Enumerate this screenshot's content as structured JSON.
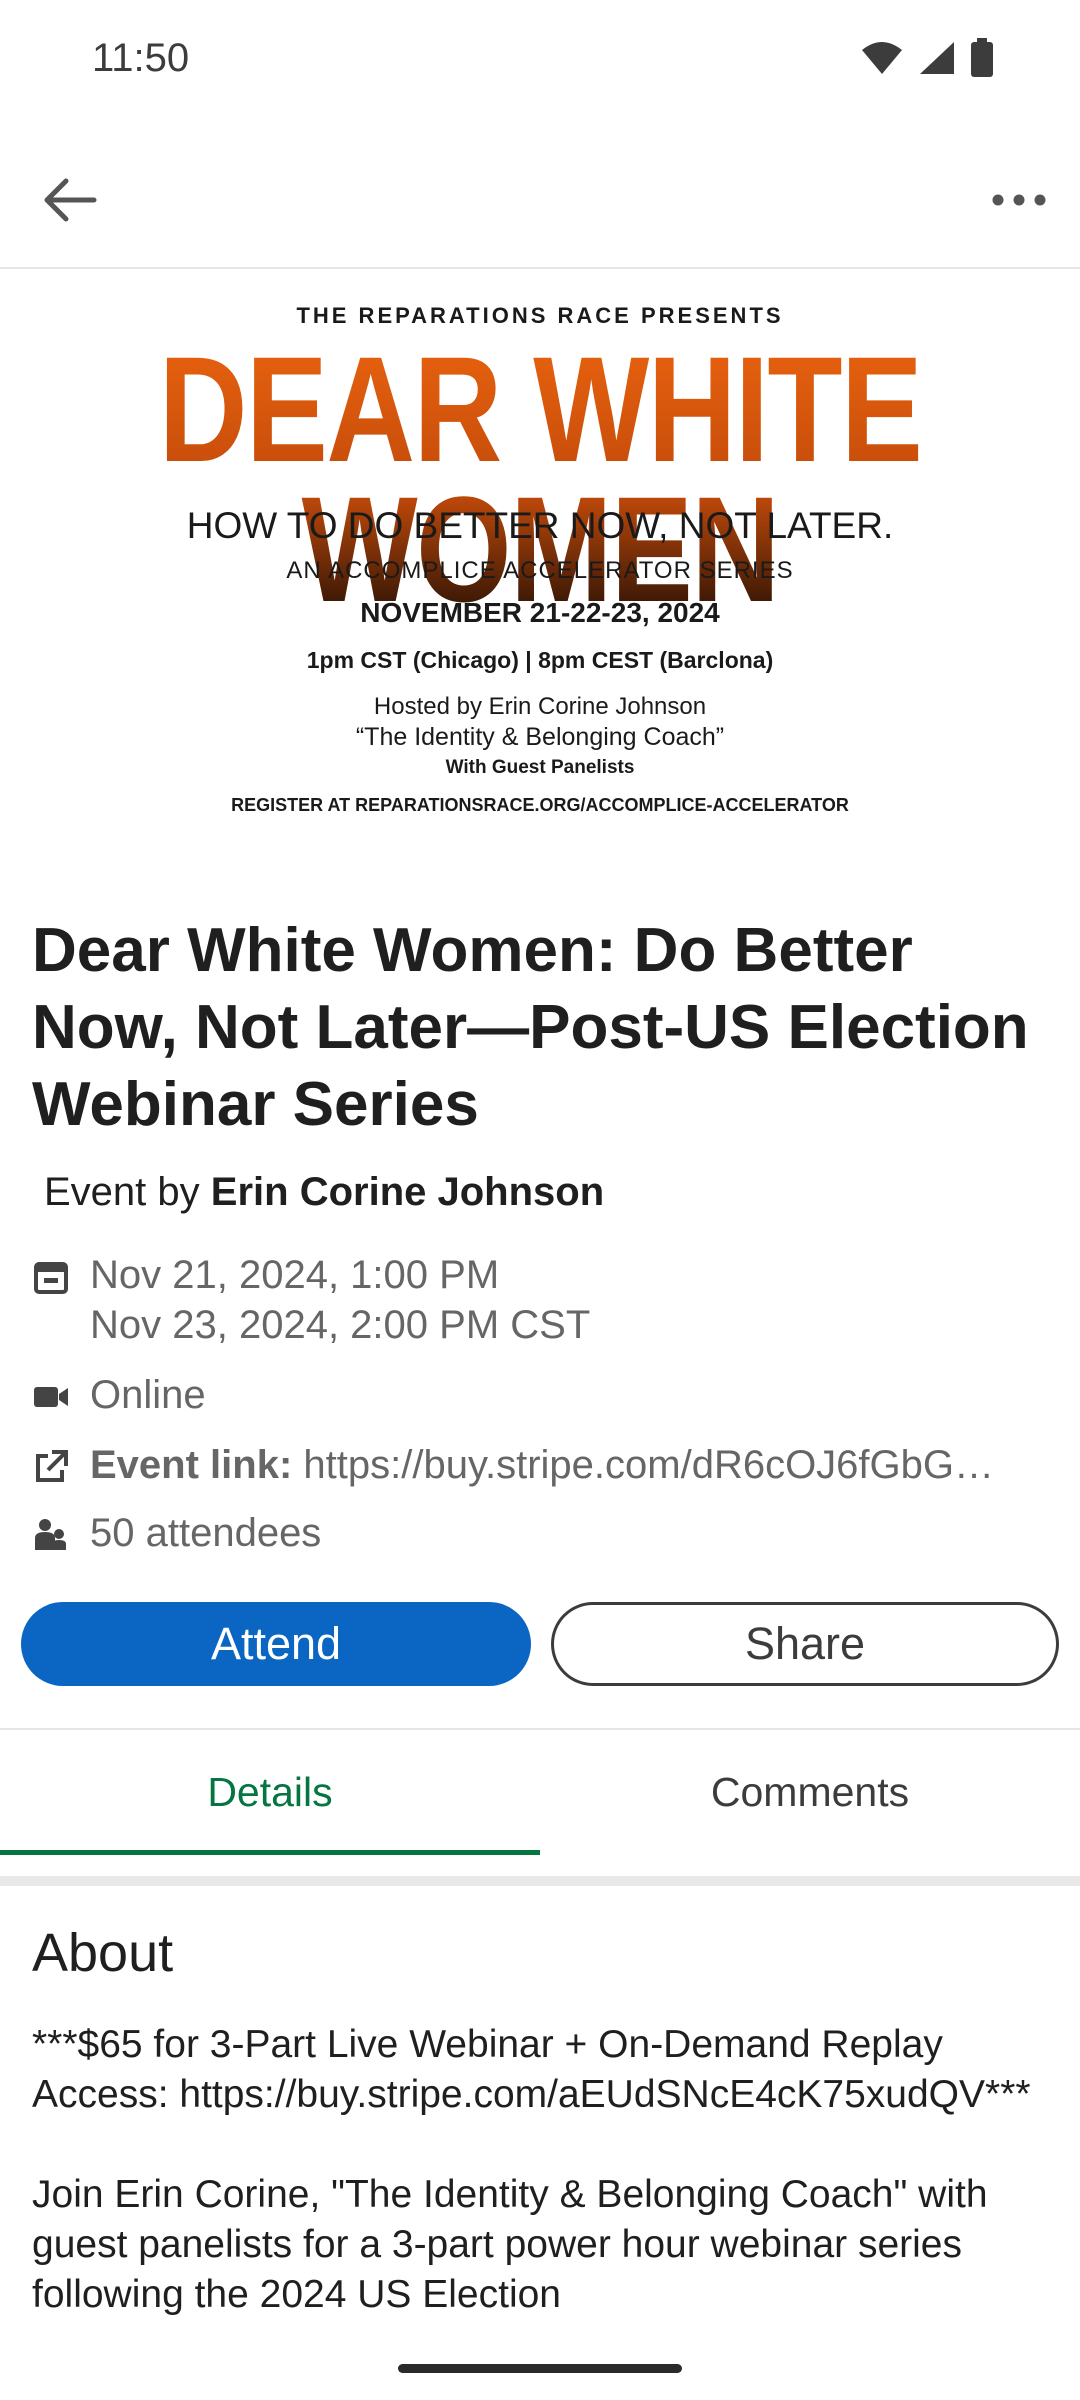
{
  "status_bar": {
    "time": "11:50"
  },
  "banner": {
    "presents": "THE REPARATIONS RACE PRESENTS",
    "title": "DEAR WHITE WOMEN",
    "subtitle": "HOW TO DO BETTER NOW, NOT LATER.",
    "series": "AN ACCOMPLICE ACCELERATOR SERIES",
    "dates": "NOVEMBER 21-22-23, 2024",
    "times": "1pm CST (Chicago) | 8pm CEST (Barclona)",
    "hosted": "Hosted by Erin Corine Johnson",
    "coach": "“The Identity & Belonging Coach”",
    "panelists": "With Guest Panelists",
    "register": "REGISTER AT REPARATIONSRACE.ORG/ACCOMPLICE-ACCELERATOR"
  },
  "event": {
    "title": "Dear White Women: Do Better Now, Not Later—Post-US Election Webinar Series",
    "by_prefix": "Event by",
    "organizer": "Erin Corine Johnson",
    "start": "Nov 21, 2024, 1:00 PM",
    "end": "Nov 23, 2024, 2:00 PM CST",
    "location": "Online",
    "link_label": "Event link:",
    "link_url": "https://buy.stripe.com/dR6cOJ6fGbG…",
    "attendees": "50 attendees"
  },
  "actions": {
    "attend": "Attend",
    "share": "Share"
  },
  "tabs": [
    {
      "label": "Details"
    },
    {
      "label": "Comments"
    }
  ],
  "about": {
    "heading": "About",
    "p1": "***$65 for 3-Part Live Webinar + On-Demand Replay Access: https://buy.stripe.com/aEUdSNcE4cK75xudQV***",
    "p2": "Join Erin Corine, \"The Identity & Belonging Coach\" with guest panelists for a 3-part power hour webinar series following the 2024 US Election"
  },
  "colors": {
    "accent": "#0a66c2",
    "tab_active": "#057642",
    "banner_orange": "#e8620f"
  },
  "icons": [
    "wifi-icon",
    "signal-icon",
    "battery-icon",
    "back-arrow-icon",
    "more-icon",
    "calendar-icon",
    "video-icon",
    "external-link-icon",
    "people-icon"
  ]
}
